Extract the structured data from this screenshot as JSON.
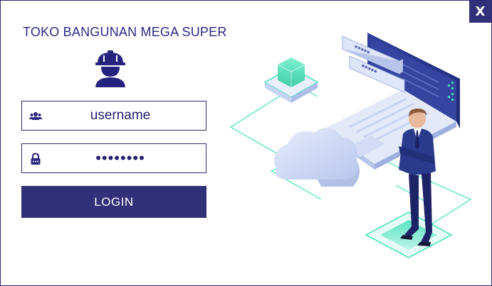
{
  "window": {
    "close_label": "X"
  },
  "app": {
    "title": "TOKO BANGUNAN MEGA SUPER"
  },
  "form": {
    "username_value": "username",
    "username_placeholder": "username",
    "password_value": "••••••••",
    "login_label": "LOGIN"
  },
  "icons": {
    "avatar": "worker-helmet-icon",
    "username": "users-icon",
    "password": "lock-icon",
    "close": "close-icon"
  },
  "colors": {
    "primary": "#33307a",
    "title": "#2b2a86",
    "accent_green": "#3fe0b8",
    "illustration_blue": "#2f3f9e"
  }
}
